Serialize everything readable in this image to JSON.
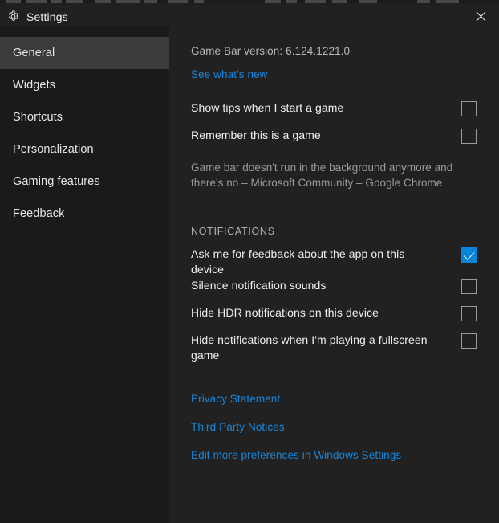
{
  "window": {
    "title": "Settings",
    "gear_icon": "gear-icon",
    "close_icon": "close-icon"
  },
  "sidebar": {
    "items": [
      {
        "label": "General",
        "selected": true
      },
      {
        "label": "Widgets",
        "selected": false
      },
      {
        "label": "Shortcuts",
        "selected": false
      },
      {
        "label": "Personalization",
        "selected": false
      },
      {
        "label": "Gaming features",
        "selected": false
      },
      {
        "label": "Feedback",
        "selected": false
      }
    ]
  },
  "content": {
    "version_text": "Game Bar version: 6.124.1221.0",
    "whats_new_link": "See what's new",
    "options": [
      {
        "label": "Show tips when I start a game",
        "checked": false
      },
      {
        "label": "Remember this is a game",
        "checked": false
      }
    ],
    "description": "Game bar doesn't run in the background anymore and there's no – Microsoft Community – Google Chrome",
    "notifications_heading": "NOTIFICATIONS",
    "notification_options": [
      {
        "label": "Ask me for feedback about the app on this device",
        "checked": true
      },
      {
        "label": "Silence notification sounds",
        "checked": false
      },
      {
        "label": "Hide HDR notifications on this device",
        "checked": false
      },
      {
        "label": "Hide notifications when I'm playing a fullscreen game",
        "checked": false
      }
    ],
    "links": [
      "Privacy Statement",
      "Third Party Notices",
      "Edit more preferences in Windows Settings"
    ]
  },
  "colors": {
    "accent_blue": "#0a84d8",
    "link_blue": "#1a86d9",
    "sidebar_bg": "#1a1a1a",
    "content_bg": "#212121",
    "selected_bg": "#3b3b3b"
  }
}
